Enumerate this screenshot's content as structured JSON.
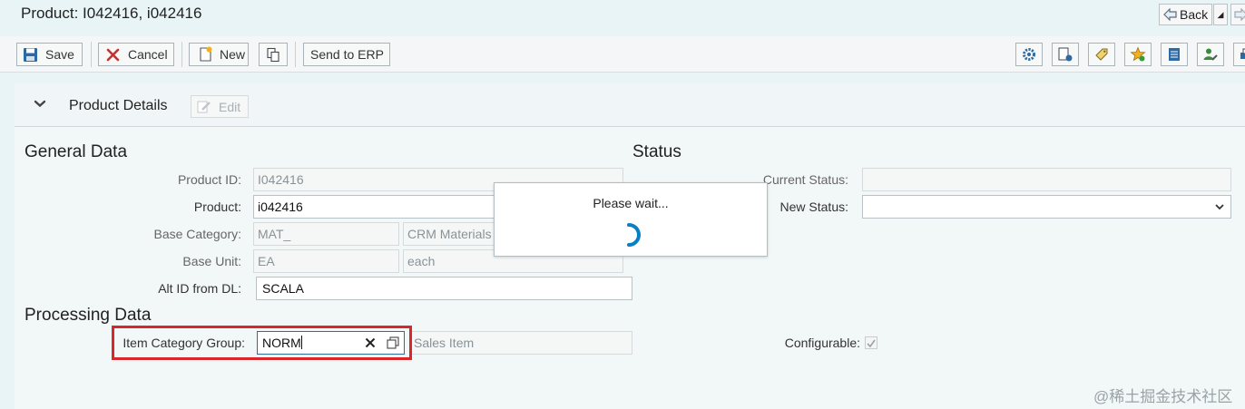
{
  "header": {
    "title": "Product: I042416, i042416",
    "back_label": "Back"
  },
  "toolbar": {
    "save_label": "Save",
    "cancel_label": "Cancel",
    "new_label": "New",
    "send_label": "Send to ERP",
    "right_icons": [
      "gear-icon",
      "document-settings-icon",
      "tag-icon",
      "star-add-icon",
      "notes-icon",
      "user-edit-icon",
      "print-icon"
    ]
  },
  "panel": {
    "title": "Product Details",
    "edit_label": "Edit"
  },
  "general": {
    "title": "General Data",
    "product_id_label": "Product ID:",
    "product_id_value": "I042416",
    "product_label": "Product:",
    "product_value": "i042416",
    "base_category_label": "Base Category:",
    "base_category_value": "MAT_",
    "base_category_desc": "CRM Materials",
    "base_unit_label": "Base Unit:",
    "base_unit_value": "EA",
    "base_unit_desc": "each",
    "alt_id_label": "Alt ID from DL:",
    "alt_id_value": "SCALA"
  },
  "status": {
    "title": "Status",
    "current_label": "Current Status:",
    "current_value": "",
    "new_label": "New Status:",
    "new_value": ""
  },
  "processing": {
    "title": "Processing Data",
    "item_cat_label": "Item Category Group:",
    "item_cat_value": "NORM",
    "item_cat_desc": "Sales Item",
    "configurable_label": "Configurable:",
    "configurable_checked": true
  },
  "dialog": {
    "text": "Please wait..."
  },
  "watermark": "@稀土掘金技术社区",
  "colors": {
    "highlight": "#d9262a",
    "busy": "#0a7fc4",
    "cancel_x": "#c9302c"
  }
}
